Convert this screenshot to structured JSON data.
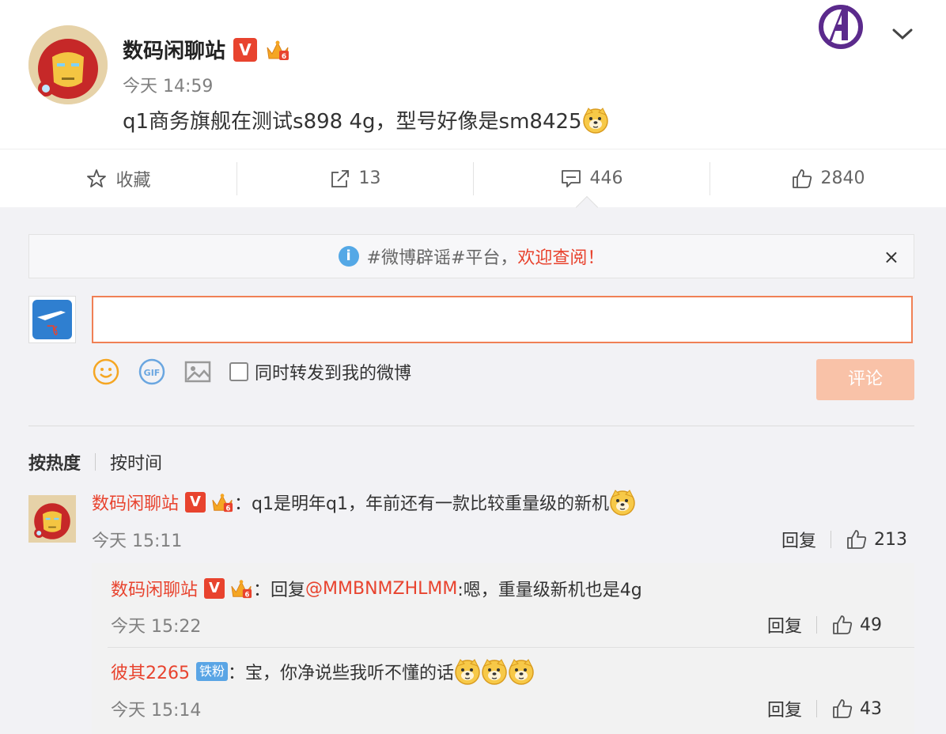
{
  "post": {
    "author": "数码闲聊站",
    "time": "今天 14:59",
    "text": "q1商务旗舰在测试s898 4g，型号好像是sm8425"
  },
  "actions": [
    {
      "icon": "star-icon",
      "label": "收藏"
    },
    {
      "icon": "share-icon",
      "label": "13"
    },
    {
      "icon": "comment-icon",
      "label": "446"
    },
    {
      "icon": "like-icon",
      "label": "2840"
    }
  ],
  "notice": {
    "text": "#微博辟谣#平台，",
    "link": "欢迎查阅！",
    "close": "×"
  },
  "composer": {
    "repost_label": "同时转发到我的微博",
    "submit_label": "评论"
  },
  "sort": {
    "hot": "按热度",
    "time": "按时间"
  },
  "comments": [
    {
      "user": "数码闲聊站",
      "text": "：q1是明年q1，年前还有一款比较重量级的新机",
      "time": "今天 15:11",
      "reply_label": "回复",
      "likes": "213"
    }
  ],
  "replies": [
    {
      "user": "数码闲聊站",
      "prefix": "：回复",
      "mention": "@MMBNMZHLMM",
      "text": ":嗯，重量级新机也是4g",
      "time": "今天 15:22",
      "reply_label": "回复",
      "likes": "49"
    },
    {
      "user": "彼其2265",
      "badge": "铁粉",
      "text": "：宝，你净说些我听不懂的话",
      "time": "今天 15:14",
      "reply_label": "回复",
      "likes": "43"
    }
  ],
  "colors": {
    "accent": "#e8432e",
    "submit": "#f9c2a8",
    "info": "#54a8e6"
  }
}
